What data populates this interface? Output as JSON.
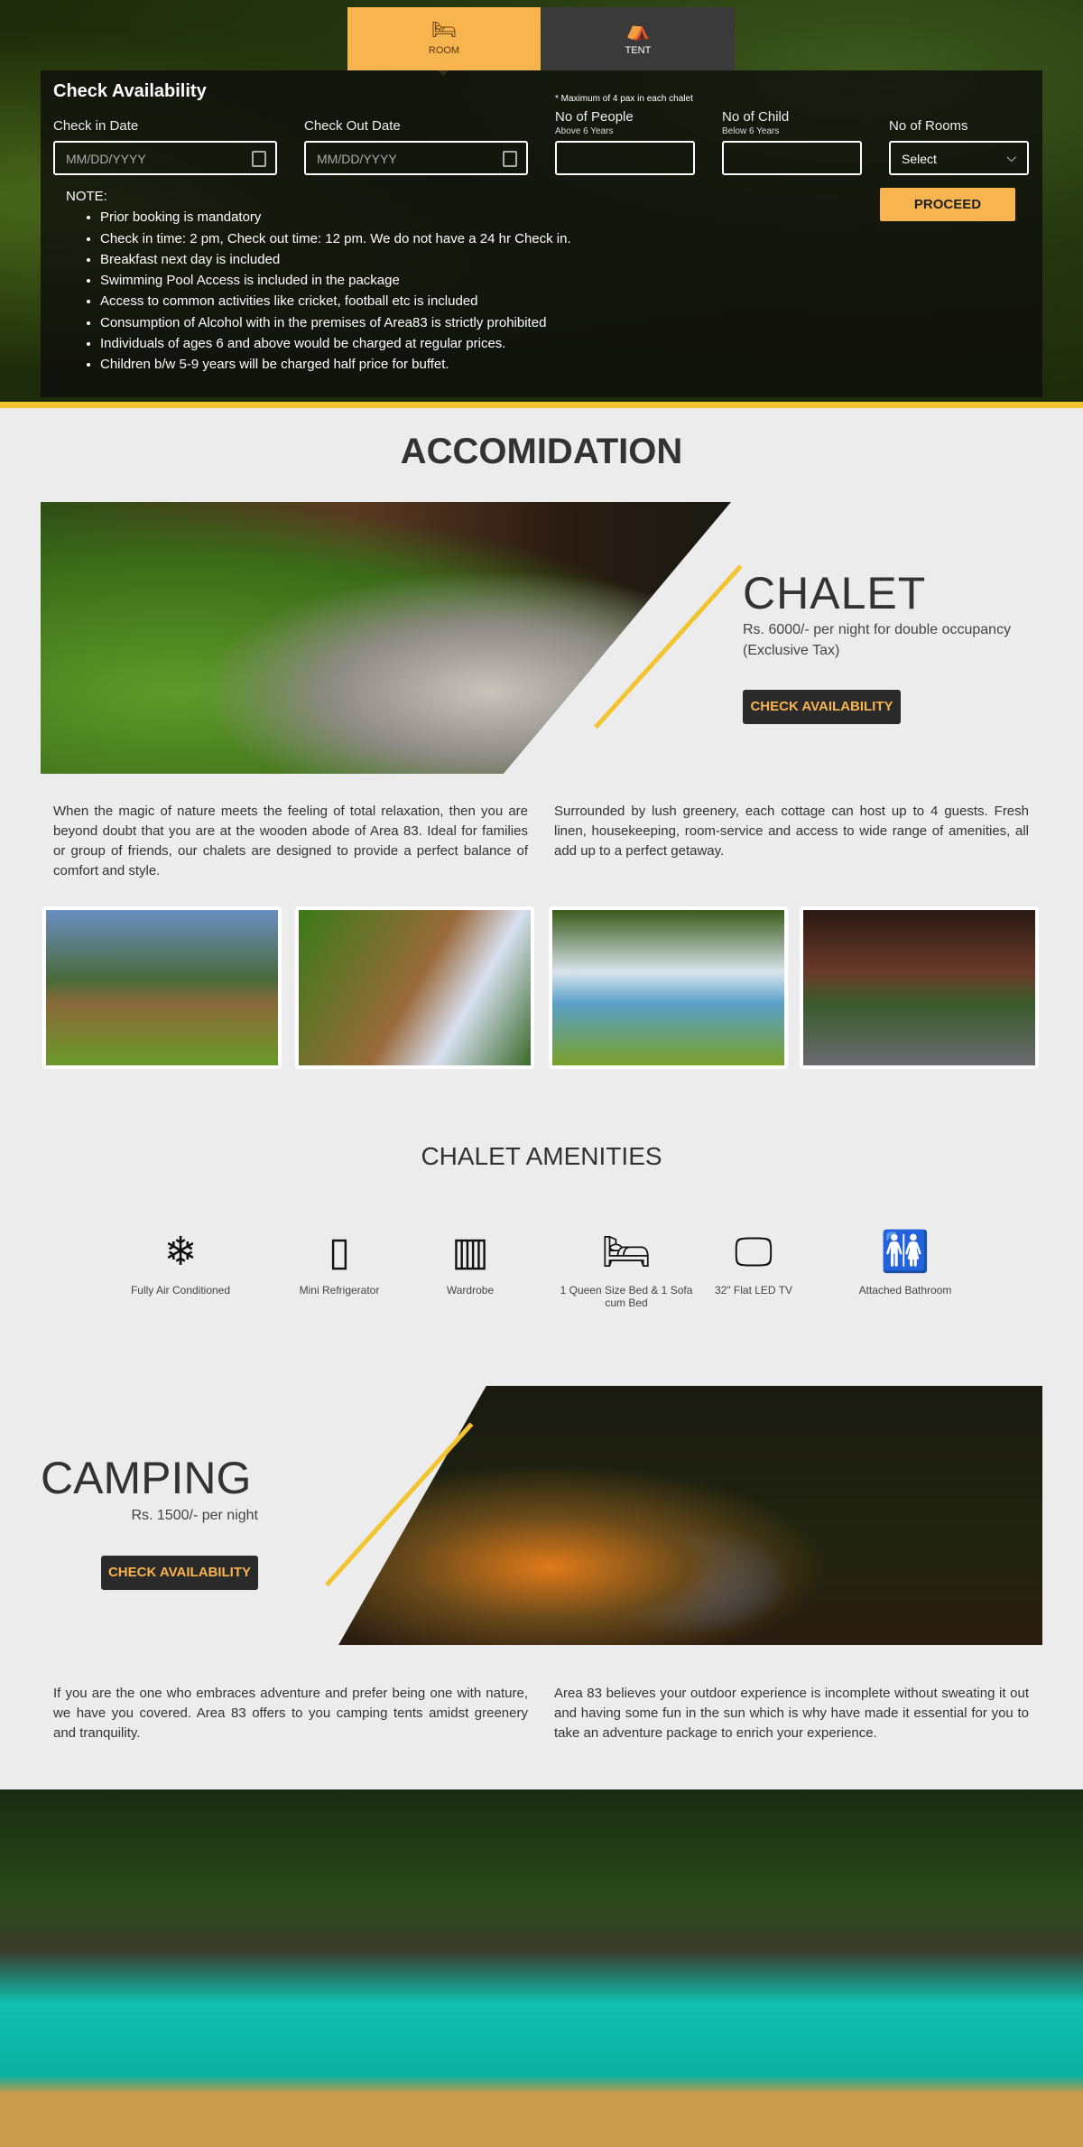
{
  "tabs": [
    {
      "label": "ROOM",
      "icon": "bed-icon"
    },
    {
      "label": "TENT",
      "icon": "tent-icon"
    }
  ],
  "booking": {
    "title": "Check Availability",
    "max_note": "* Maximum of 4 pax in each chalet",
    "checkin_label": "Check in Date",
    "checkout_label": "Check Out Date",
    "date_placeholder": "MM/DD/YYYY",
    "people_label": "No of People",
    "people_sub": "Above 6 Years",
    "child_label": "No of Child",
    "child_sub": "Below 6 Years",
    "rooms_label": "No of Rooms",
    "rooms_value": "Select",
    "proceed": "PROCEED",
    "note_title": "NOTE:",
    "notes": [
      "Prior booking is mandatory",
      "Check in time: 2 pm, Check out time: 12 pm. We do not have a 24 hr Check in.",
      "Breakfast next day is included",
      "Swimming Pool Access is included in the package",
      "Access to common activities like cricket, football etc is included",
      "Consumption of Alcohol with in the premises of Area83 is strictly prohibited",
      "Individuals of ages 6 and above would be charged at regular prices.",
      "Children b/w 5-9 years will be charged half price for buffet."
    ]
  },
  "accommodation": {
    "title": "ACCOMIDATION"
  },
  "chalet": {
    "title": "CHALET",
    "price": "Rs. 6000/- per night for double occupancy",
    "tax": "(Exclusive Tax)",
    "button": "CHECK AVAILABILITY",
    "para1": "When the magic of nature meets the feeling of total relaxation, then you are beyond doubt that you are at the wooden abode of Area 83. Ideal for families or group of friends, our chalets are designed to provide a perfect balance of comfort and style.",
    "para2": "Surrounded by lush greenery, each cottage can host up to 4 guests. Fresh linen, housekeeping, room-service and access to wide range of amenities, all add up to a perfect getaway."
  },
  "amenities": {
    "title": "CHALET AMENITIES",
    "items": [
      {
        "label": "Fully Air Conditioned",
        "icon": "snowflake-icon"
      },
      {
        "label": "Mini Refrigerator",
        "icon": "refrigerator-icon"
      },
      {
        "label": "Wardrobe",
        "icon": "wardrobe-icon"
      },
      {
        "label": "1 Queen Size Bed & 1 Sofa cum Bed",
        "icon": "bed-icon"
      },
      {
        "label": "32\" Flat LED TV",
        "icon": "tv-icon"
      },
      {
        "label": "Attached Bathroom",
        "icon": "restroom-icon"
      }
    ]
  },
  "camping": {
    "title": "CAMPING",
    "price": "Rs. 1500/- per night",
    "button": "CHECK AVAILABILITY",
    "para1": "If you are the one who embraces adventure and prefer being one with nature, we have you covered. Area 83 offers to you camping tents amidst greenery and tranquility.",
    "para2": "Area 83 believes your outdoor experience is incomplete without sweating it out and having some fun in the sun which is why have made it essential for you to take an adventure package to enrich your experience."
  },
  "colors": {
    "accent": "#f8b44f",
    "yellow_line": "#f2c530",
    "dark": "#2a2a2a"
  }
}
